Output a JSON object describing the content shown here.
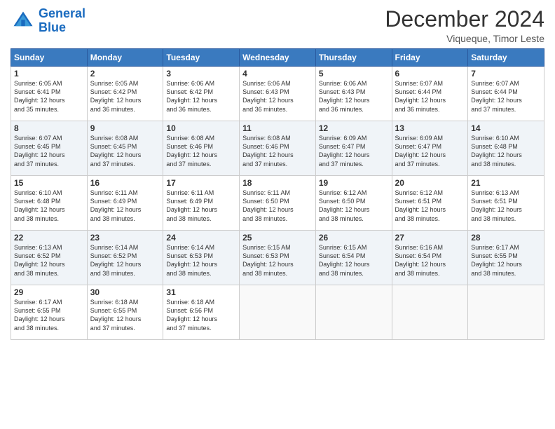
{
  "logo": {
    "line1": "General",
    "line2": "Blue"
  },
  "header": {
    "month": "December 2024",
    "location": "Viqueque, Timor Leste"
  },
  "weekdays": [
    "Sunday",
    "Monday",
    "Tuesday",
    "Wednesday",
    "Thursday",
    "Friday",
    "Saturday"
  ],
  "weeks": [
    [
      {
        "day": "1",
        "info": "Sunrise: 6:05 AM\nSunset: 6:41 PM\nDaylight: 12 hours\nand 35 minutes."
      },
      {
        "day": "2",
        "info": "Sunrise: 6:05 AM\nSunset: 6:42 PM\nDaylight: 12 hours\nand 36 minutes."
      },
      {
        "day": "3",
        "info": "Sunrise: 6:06 AM\nSunset: 6:42 PM\nDaylight: 12 hours\nand 36 minutes."
      },
      {
        "day": "4",
        "info": "Sunrise: 6:06 AM\nSunset: 6:43 PM\nDaylight: 12 hours\nand 36 minutes."
      },
      {
        "day": "5",
        "info": "Sunrise: 6:06 AM\nSunset: 6:43 PM\nDaylight: 12 hours\nand 36 minutes."
      },
      {
        "day": "6",
        "info": "Sunrise: 6:07 AM\nSunset: 6:44 PM\nDaylight: 12 hours\nand 36 minutes."
      },
      {
        "day": "7",
        "info": "Sunrise: 6:07 AM\nSunset: 6:44 PM\nDaylight: 12 hours\nand 37 minutes."
      }
    ],
    [
      {
        "day": "8",
        "info": "Sunrise: 6:07 AM\nSunset: 6:45 PM\nDaylight: 12 hours\nand 37 minutes."
      },
      {
        "day": "9",
        "info": "Sunrise: 6:08 AM\nSunset: 6:45 PM\nDaylight: 12 hours\nand 37 minutes."
      },
      {
        "day": "10",
        "info": "Sunrise: 6:08 AM\nSunset: 6:46 PM\nDaylight: 12 hours\nand 37 minutes."
      },
      {
        "day": "11",
        "info": "Sunrise: 6:08 AM\nSunset: 6:46 PM\nDaylight: 12 hours\nand 37 minutes."
      },
      {
        "day": "12",
        "info": "Sunrise: 6:09 AM\nSunset: 6:47 PM\nDaylight: 12 hours\nand 37 minutes."
      },
      {
        "day": "13",
        "info": "Sunrise: 6:09 AM\nSunset: 6:47 PM\nDaylight: 12 hours\nand 37 minutes."
      },
      {
        "day": "14",
        "info": "Sunrise: 6:10 AM\nSunset: 6:48 PM\nDaylight: 12 hours\nand 38 minutes."
      }
    ],
    [
      {
        "day": "15",
        "info": "Sunrise: 6:10 AM\nSunset: 6:48 PM\nDaylight: 12 hours\nand 38 minutes."
      },
      {
        "day": "16",
        "info": "Sunrise: 6:11 AM\nSunset: 6:49 PM\nDaylight: 12 hours\nand 38 minutes."
      },
      {
        "day": "17",
        "info": "Sunrise: 6:11 AM\nSunset: 6:49 PM\nDaylight: 12 hours\nand 38 minutes."
      },
      {
        "day": "18",
        "info": "Sunrise: 6:11 AM\nSunset: 6:50 PM\nDaylight: 12 hours\nand 38 minutes."
      },
      {
        "day": "19",
        "info": "Sunrise: 6:12 AM\nSunset: 6:50 PM\nDaylight: 12 hours\nand 38 minutes."
      },
      {
        "day": "20",
        "info": "Sunrise: 6:12 AM\nSunset: 6:51 PM\nDaylight: 12 hours\nand 38 minutes."
      },
      {
        "day": "21",
        "info": "Sunrise: 6:13 AM\nSunset: 6:51 PM\nDaylight: 12 hours\nand 38 minutes."
      }
    ],
    [
      {
        "day": "22",
        "info": "Sunrise: 6:13 AM\nSunset: 6:52 PM\nDaylight: 12 hours\nand 38 minutes."
      },
      {
        "day": "23",
        "info": "Sunrise: 6:14 AM\nSunset: 6:52 PM\nDaylight: 12 hours\nand 38 minutes."
      },
      {
        "day": "24",
        "info": "Sunrise: 6:14 AM\nSunset: 6:53 PM\nDaylight: 12 hours\nand 38 minutes."
      },
      {
        "day": "25",
        "info": "Sunrise: 6:15 AM\nSunset: 6:53 PM\nDaylight: 12 hours\nand 38 minutes."
      },
      {
        "day": "26",
        "info": "Sunrise: 6:15 AM\nSunset: 6:54 PM\nDaylight: 12 hours\nand 38 minutes."
      },
      {
        "day": "27",
        "info": "Sunrise: 6:16 AM\nSunset: 6:54 PM\nDaylight: 12 hours\nand 38 minutes."
      },
      {
        "day": "28",
        "info": "Sunrise: 6:17 AM\nSunset: 6:55 PM\nDaylight: 12 hours\nand 38 minutes."
      }
    ],
    [
      {
        "day": "29",
        "info": "Sunrise: 6:17 AM\nSunset: 6:55 PM\nDaylight: 12 hours\nand 38 minutes."
      },
      {
        "day": "30",
        "info": "Sunrise: 6:18 AM\nSunset: 6:55 PM\nDaylight: 12 hours\nand 37 minutes."
      },
      {
        "day": "31",
        "info": "Sunrise: 6:18 AM\nSunset: 6:56 PM\nDaylight: 12 hours\nand 37 minutes."
      },
      null,
      null,
      null,
      null
    ]
  ]
}
